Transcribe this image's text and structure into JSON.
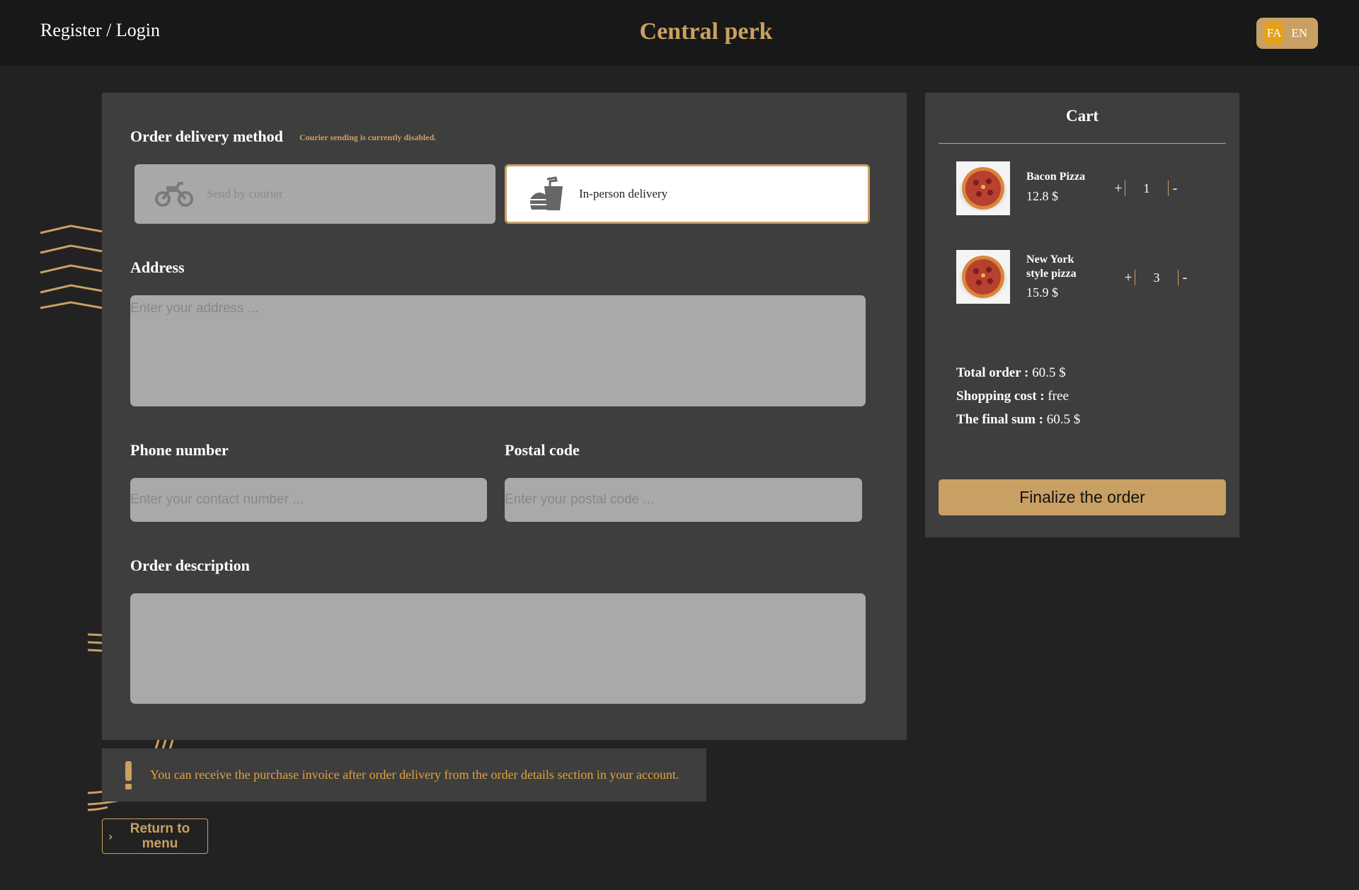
{
  "header": {
    "auth_link": "Register / Login",
    "brand": "Central perk",
    "languages": [
      {
        "code": "FA",
        "active": true
      },
      {
        "code": "EN",
        "active": false
      }
    ]
  },
  "delivery": {
    "title": "Order delivery method",
    "notice": "Courier sending is currently disabled.",
    "options": [
      {
        "label": "Send by courier",
        "icon": "motorcycle-icon",
        "state": "disabled"
      },
      {
        "label": "In-person delivery",
        "icon": "food-takeaway-icon",
        "state": "selected"
      }
    ]
  },
  "address": {
    "label": "Address",
    "placeholder": "Enter your address ...",
    "value": ""
  },
  "phone": {
    "label": "Phone number",
    "placeholder": "Enter your contact number ...",
    "value": ""
  },
  "postal": {
    "label": "Postal code",
    "placeholder": "Enter your postal code ...",
    "value": ""
  },
  "description": {
    "label": "Order description",
    "value": ""
  },
  "info_message": "You can receive the purchase invoice after order delivery from the order details section in your account.",
  "return_button": "Return to menu",
  "cart": {
    "title": "Cart",
    "items": [
      {
        "name": "Bacon Pizza",
        "price": "12.8 $",
        "quantity": "1"
      },
      {
        "name": "New York style pizza",
        "price": "15.9 $",
        "quantity": "3"
      }
    ],
    "plus_label": "+",
    "minus_label": "-",
    "total_label": "Total order :",
    "total_value": "60.5 $",
    "shipping_label": "Shopping cost :",
    "shipping_value": "free",
    "final_label": "The final sum :",
    "final_value": "60.5 $",
    "finalize_button": "Finalize the order"
  },
  "colors": {
    "accent": "#c9a063",
    "warning_text": "#e0a23c",
    "panel": "#3e3e3e",
    "background": "#222222"
  }
}
